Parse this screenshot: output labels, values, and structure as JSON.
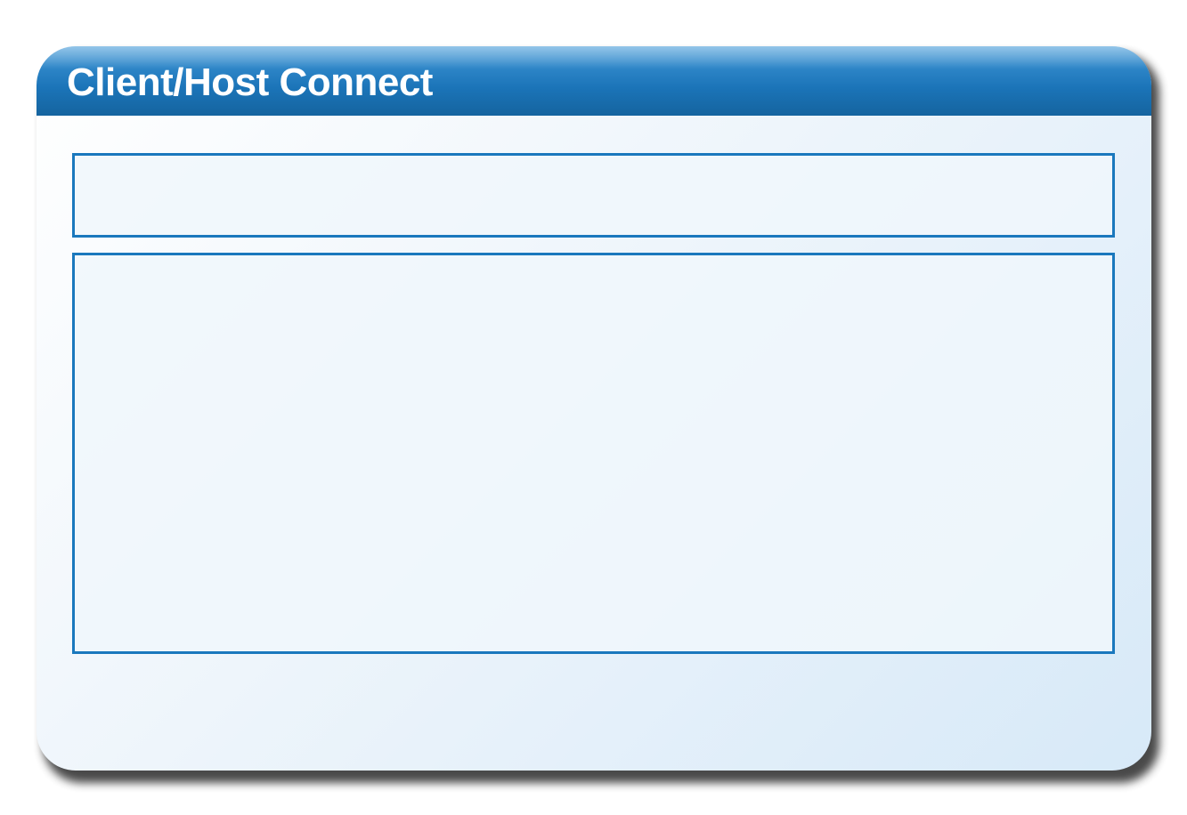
{
  "window": {
    "title": "Client/Host Connect"
  },
  "colors": {
    "accent": "#1a78bd",
    "titlebar": "#1b74b8",
    "background": "#eef5fb"
  }
}
